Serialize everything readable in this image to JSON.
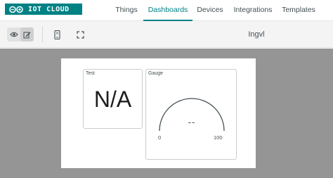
{
  "app": {
    "logo_text": "IOT CLOUD",
    "brand_color": "#008184"
  },
  "nav": {
    "items": [
      {
        "label": "Things",
        "active": false
      },
      {
        "label": "Dashboards",
        "active": true
      },
      {
        "label": "Devices",
        "active": false
      },
      {
        "label": "Integrations",
        "active": false
      },
      {
        "label": "Templates",
        "active": false
      }
    ]
  },
  "toolbar": {
    "view_mode_icon": "eye-icon",
    "edit_mode_icon": "pencil-icon",
    "mobile_icon": "phone-icon",
    "fullscreen_icon": "expand-icon",
    "dashboard_name": "Ingvl"
  },
  "widgets": {
    "value": {
      "title": "Test",
      "value": "N/A"
    },
    "gauge": {
      "title": "Gauge",
      "value": "--",
      "min": "0",
      "max": "100"
    }
  }
}
